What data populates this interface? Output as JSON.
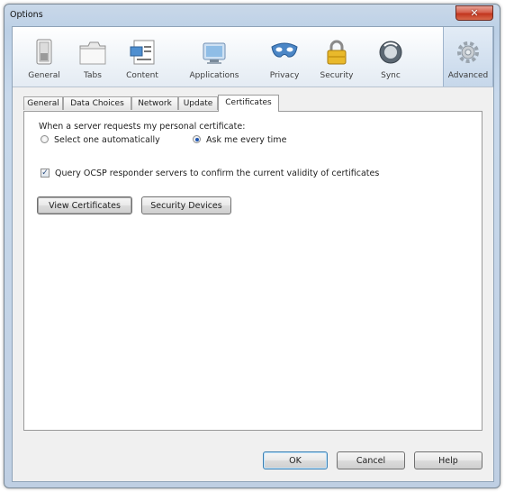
{
  "window": {
    "title": "Options",
    "close_glyph": "✕"
  },
  "toolbar": {
    "panes": [
      {
        "label": "General",
        "icon": "general-switch-icon"
      },
      {
        "label": "Tabs",
        "icon": "tabs-icon"
      },
      {
        "label": "Content",
        "icon": "content-icon"
      },
      {
        "label": "Applications",
        "icon": "applications-icon"
      },
      {
        "label": "Privacy",
        "icon": "privacy-mask-icon"
      },
      {
        "label": "Security",
        "icon": "padlock-icon"
      },
      {
        "label": "Sync",
        "icon": "sync-icon"
      },
      {
        "label": "Advanced",
        "icon": "gear-icon",
        "selected": true
      }
    ]
  },
  "tabs": [
    {
      "label": "General"
    },
    {
      "label": "Data Choices"
    },
    {
      "label": "Network"
    },
    {
      "label": "Update"
    },
    {
      "label": "Certificates",
      "active": true
    }
  ],
  "certificates": {
    "prompt": "When a server requests my personal certificate:",
    "option_auto": "Select one automatically",
    "option_auto_selected": false,
    "option_ask": "Ask me every time",
    "option_ask_selected": true,
    "ocsp_label": "Query OCSP responder servers to confirm the current validity of certificates",
    "ocsp_checked": true,
    "view_certificates": "View Certificates",
    "security_devices": "Security Devices"
  },
  "footer": {
    "ok": "OK",
    "cancel": "Cancel",
    "help": "Help"
  },
  "colors": {
    "selected_pane": "#c6d7ea",
    "radio_dot": "#1f56b3",
    "close_button": "#c2361f"
  }
}
